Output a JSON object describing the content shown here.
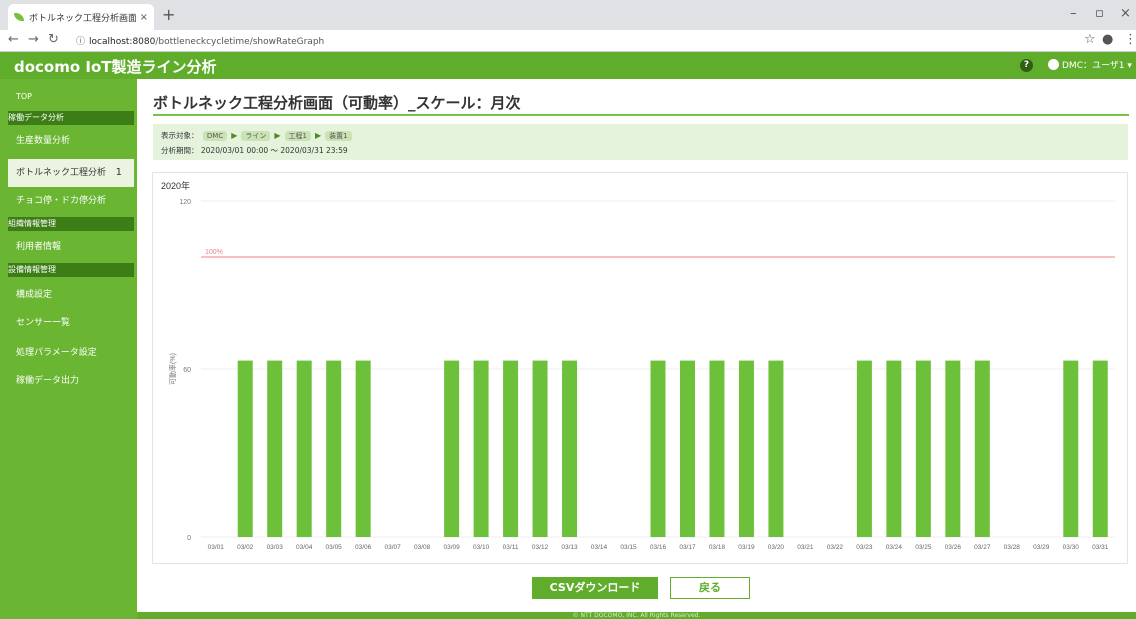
{
  "browser": {
    "tab_title": "ボトルネック工程分析画面（可動率）",
    "tab_close": "×",
    "new_tab": "+",
    "url_prefix": "localhost:8080",
    "url_path": "/bottleneckcycletime/showRateGraph"
  },
  "header": {
    "app_title": "docomo IoT製造ライン分析",
    "help": "?",
    "user": "DMC：ユーザ1 ▾"
  },
  "sidebar": {
    "top": "TOP",
    "sections": [
      {
        "heading": "稼働データ分析",
        "items": [
          {
            "label": "生産数量分析"
          },
          {
            "label": "ボトルネック工程分析",
            "active": true,
            "count": "1"
          },
          {
            "label": "チョコ停・ドカ停分析"
          }
        ]
      },
      {
        "heading": "組織情報管理",
        "items": [
          {
            "label": "利用者情報"
          }
        ]
      },
      {
        "heading": "設備情報管理",
        "items": [
          {
            "label": "構成設定"
          },
          {
            "label": "センサー一覧"
          },
          {
            "label": "処理パラメータ設定"
          },
          {
            "label": "稼働データ出力"
          }
        ]
      }
    ]
  },
  "page": {
    "title": "ボトルネック工程分析画面（可動率）_スケール：月次",
    "target_label": "表示対象：",
    "crumbs": [
      "DMC",
      "ライン",
      "工程1",
      "装置1"
    ],
    "period_label": "分析期間：",
    "period_value": "2020/03/01 00:00 ～ 2020/03/31 23:59",
    "csv_button": "CSVダウンロード",
    "back_button": "戻る",
    "footer": "© NTT DOCOMO, INC. All Rights Reserved."
  },
  "chart_data": {
    "type": "bar",
    "title": "2020年",
    "ylabel": "可動率(%)",
    "ylim": [
      0,
      120
    ],
    "yticks": [
      0,
      60,
      120
    ],
    "reference_line": {
      "value": 100,
      "label": "100%",
      "color": "#f08080"
    },
    "bar_color": "#6cc03a",
    "categories": [
      "03/01",
      "03/02",
      "03/03",
      "03/04",
      "03/05",
      "03/06",
      "03/07",
      "03/08",
      "03/09",
      "03/10",
      "03/11",
      "03/12",
      "03/13",
      "03/14",
      "03/15",
      "03/16",
      "03/17",
      "03/18",
      "03/19",
      "03/20",
      "03/21",
      "03/22",
      "03/23",
      "03/24",
      "03/25",
      "03/26",
      "03/27",
      "03/28",
      "03/29",
      "03/30",
      "03/31"
    ],
    "values": [
      0,
      63,
      63,
      63,
      63,
      63,
      0,
      0,
      63,
      63,
      63,
      63,
      63,
      0,
      0,
      63,
      63,
      63,
      63,
      63,
      0,
      0,
      63,
      63,
      63,
      63,
      63,
      0,
      0,
      63,
      63
    ]
  }
}
